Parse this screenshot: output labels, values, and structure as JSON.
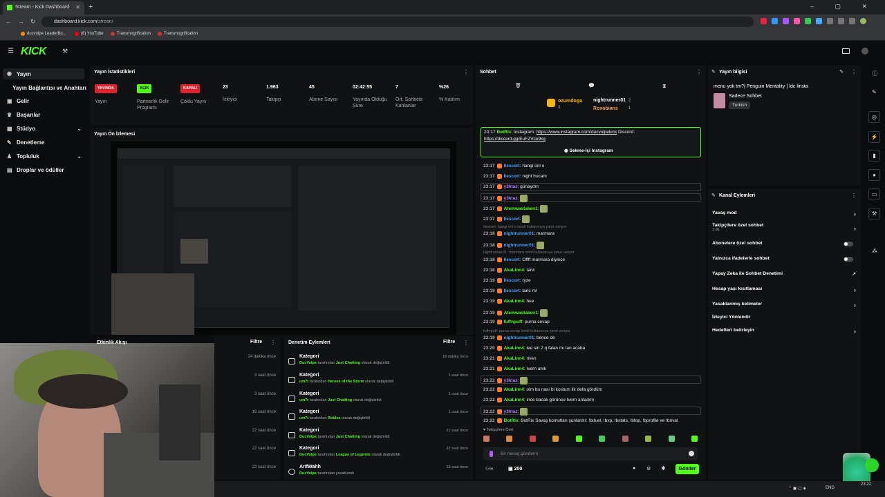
{
  "browser": {
    "tab_title": "Stream - Kick Dashboard",
    "url_host": "dashboard.kick.com",
    "url_path": "/stream",
    "bookmarks": [
      "ducvolpe LeaderBo...",
      "(6) YouTube",
      "Transmogrification",
      "Transmogrification"
    ]
  },
  "sidebar": {
    "items": [
      {
        "label": "Yayın",
        "icon": "broadcast-icon"
      },
      {
        "label": "Yayın Bağlantısı ve Anahtarı",
        "icon": ""
      },
      {
        "label": "Gelir",
        "icon": "money-icon"
      },
      {
        "label": "Başarılar",
        "icon": "trophy-icon"
      },
      {
        "label": "Stüdyo",
        "icon": "studio-icon"
      },
      {
        "label": "Denetleme",
        "icon": "wrench-icon"
      },
      {
        "label": "Topluluk",
        "icon": "community-icon"
      },
      {
        "label": "Droplar ve ödüller",
        "icon": "gift-icon"
      }
    ]
  },
  "stats": {
    "title": "Yayın İstatistikleri",
    "columns": [
      {
        "badge": "YAYINDA",
        "badge_color": "#e0212e",
        "label": "Yayın"
      },
      {
        "badge": "AÇIK",
        "badge_color": "#53fc18",
        "label": "Partnerlik Gelir Programı"
      },
      {
        "badge": "KAPALI",
        "badge_color": "#e0212e",
        "label": "Çoklu Yayın"
      },
      {
        "value": "23",
        "label": "İzleyici"
      },
      {
        "value": "1.963",
        "label": "Takipçi"
      },
      {
        "value": "45",
        "label": "Abone Sayısı"
      },
      {
        "value": "02:42:55",
        "label": "Yayında Olduğu Süre"
      },
      {
        "value": "7",
        "label": "Ort. Sohbete Katılanlar"
      },
      {
        "value": "%26",
        "label": "% Katılım"
      }
    ]
  },
  "preview": {
    "title": "Yayın Ön İzlemesi"
  },
  "activity": {
    "title": "Etkinlik Akışı",
    "filter": "Filtre",
    "times": [
      "24 dakika önce",
      "3 saat önce",
      "3 saat önce",
      "16 saat önce",
      "22 saat önce",
      "22 saat önce",
      "22 saat önce"
    ]
  },
  "moderation": {
    "title": "Denetim Eylemleri",
    "filter": "Filtre",
    "rows": [
      {
        "type": "Kategori",
        "user": "DucVolpe",
        "mid": "tarafından",
        "target": "Just Chatting",
        "tail": "olarak değiştirildi",
        "time": "18 dakika önce"
      },
      {
        "type": "Kategori",
        "user": "um7t",
        "mid": "tarafından",
        "target": "Heroes of the Storm",
        "tail": "olarak değiştirildi",
        "time": "1 saat önce"
      },
      {
        "type": "Kategori",
        "user": "um7t",
        "mid": "tarafından",
        "target": "Just Chatting",
        "tail": "olarak değiştirildi",
        "time": "1 saat önce"
      },
      {
        "type": "Kategori",
        "user": "um7t",
        "mid": "tarafından",
        "target": "Roblox",
        "tail": "olarak değiştirildi",
        "time": "1 saat önce"
      },
      {
        "type": "Kategori",
        "user": "DucVolpe",
        "mid": "tarafından",
        "target": "Just Chatting",
        "tail": "olarak değiştirildi",
        "time": "21 saat önce"
      },
      {
        "type": "Kategori",
        "user": "DucVolpe",
        "mid": "tarafından",
        "target": "League of Legends",
        "tail": "olarak değiştirildi",
        "time": "22 saat önce"
      },
      {
        "type": "ArifWahh",
        "user": "DucVolpe",
        "mid": "tarafından yasaklandı",
        "target": "",
        "tail": "",
        "time": "23 saat önce"
      }
    ]
  },
  "chat": {
    "title": "Sohbet",
    "top_user1": "ozumdoga",
    "top_user1_count": "3",
    "top_user2": "nightrunner01",
    "top_user2_count": "2",
    "top_user3": "Roxobians",
    "top_user3_count": "1",
    "pinned": {
      "time": "23:17",
      "user": "BotRix",
      "text": "Instagram:",
      "link": "https://www.instagram.com/ducvolpekick",
      "text2": "Discord:",
      "link2": "https://discord.gg/EuFZVce9kg",
      "button": "Sekme-İçi Instagram"
    },
    "messages": [
      {
        "time": "23:17",
        "user": "Ilescort",
        "color": "#4aa3ff",
        "text": "hangi ünl o"
      },
      {
        "time": "23:17",
        "user": "Ilescort",
        "color": "#4aa3ff",
        "text": "night hocam"
      },
      {
        "time": "23:17",
        "user": "y3ktaz",
        "color": "#b07cff",
        "text": "günaydın"
      },
      {
        "time": "23:17",
        "user": "y3ktaz",
        "color": "#b07cff",
        "text": ""
      },
      {
        "time": "23:17",
        "user": "Atemwastaken1",
        "color": "#53fc18",
        "text": ""
      },
      {
        "time": "23:17",
        "user": "Ilescort",
        "color": "#4aa3ff",
        "text": ""
      },
      {
        "time": "",
        "user": "",
        "color": "",
        "text": "Ilescort: hangi ünl o isimli kullanıcıya yanıt veriyor"
      },
      {
        "time": "23:18",
        "user": "nightrunner01",
        "color": "#4aa3ff",
        "text": "marmara"
      },
      {
        "time": "23:18",
        "user": "nightrunner01",
        "color": "#4aa3ff",
        "text": ""
      },
      {
        "time": "",
        "user": "",
        "color": "",
        "text": "nightrunner01: marmara isimli kullanıcıya yanıt veriyor"
      },
      {
        "time": "23:18",
        "user": "Ilescort",
        "color": "#4aa3ff",
        "text": "Offff marmara diyince"
      },
      {
        "time": "23:18",
        "user": "AkaLinn4",
        "color": "#53fc18",
        "text": "taric"
      },
      {
        "time": "23:19",
        "user": "Ilescort",
        "color": "#4aa3ff",
        "text": "ryze"
      },
      {
        "time": "23:19",
        "user": "Ilescort",
        "color": "#4aa3ff",
        "text": "taric ml"
      },
      {
        "time": "23:19",
        "user": "AkaLinn4",
        "color": "#53fc18",
        "text": "hee"
      },
      {
        "time": "23:19",
        "user": "Atemwastaken1",
        "color": "#53fc18",
        "text": ""
      },
      {
        "time": "23:19",
        "user": "fuffnpuff",
        "color": "#53fc18",
        "text": "purna cevap"
      },
      {
        "time": "",
        "user": "",
        "color": "",
        "text": "fuffnpuff: purna cevap isimli kullanıcıya yanıt veriyor"
      },
      {
        "time": "23:19",
        "user": "nightrunner01",
        "color": "#4aa3ff",
        "text": "bence de"
      },
      {
        "time": "23:20",
        "user": "AkaLinn4",
        "color": "#53fc18",
        "text": "lee sin 2 q falan mı lan acaba"
      },
      {
        "time": "23:21",
        "user": "AkaLinn4",
        "color": "#53fc18",
        "text": "riven"
      },
      {
        "time": "23:21",
        "user": "AkaLinn4",
        "color": "#53fc18",
        "text": "Ivern amk"
      },
      {
        "time": "23:22",
        "user": "y3ktaz",
        "color": "#b07cff",
        "text": ""
      },
      {
        "time": "23:22",
        "user": "AkaLinn4",
        "color": "#53fc18",
        "text": "olm bu nası bi kostum ilk defa gördüm"
      },
      {
        "time": "23:22",
        "user": "AkaLinn4",
        "color": "#53fc18",
        "text": "ince bacak görünce Ivern anladım"
      },
      {
        "time": "23:22",
        "user": "y3ktaz",
        "color": "#b07cff",
        "text": ""
      },
      {
        "time": "23:22",
        "user": "BotRix",
        "color": "#53fc18",
        "text": "BotRix Savaş komutları şunlardır: !bduel, !bxp, !bstats, !btop, !bprofile ve !brival"
      }
    ],
    "followers_only_label": "Takipçilere Özel",
    "input_placeholder": "Bir mesaj gönderin",
    "points": "200",
    "send_label": "Gönder"
  },
  "info": {
    "title": "Yayın bilgisi",
    "stream_title": "menu yok tm?| Penguin Mentality | Idc linsta",
    "category": "Sadece Sohbet",
    "tag": "Turkish"
  },
  "channel_actions": {
    "title": "Kanal Eylemleri",
    "rows": [
      {
        "label": "Yavaş mod",
        "sub": "",
        "control": "arrow"
      },
      {
        "label": "Takipçilere özel sohbet",
        "sub": "1 dk.",
        "control": "arrow"
      },
      {
        "label": "Abonelere özel sohbet",
        "sub": "",
        "control": "toggle"
      },
      {
        "label": "Yalnızca ifadelerle sohbet",
        "sub": "",
        "control": "toggle"
      },
      {
        "label": "Yapay Zeka ile Sohbet Denetimi",
        "sub": "",
        "control": "external"
      },
      {
        "label": "Hesap yaşı kısıtlaması",
        "sub": "",
        "control": "arrow"
      },
      {
        "label": "Yasaklanmış kelimeler",
        "sub": "",
        "control": "arrow"
      },
      {
        "label": "İzleyici Yönlendir",
        "sub": "",
        "control": "none"
      },
      {
        "label": "Hedefleri belirleyin",
        "sub": "",
        "control": "arrow"
      }
    ]
  },
  "taskbar": {
    "lang": "ENG",
    "time": "23:22"
  }
}
